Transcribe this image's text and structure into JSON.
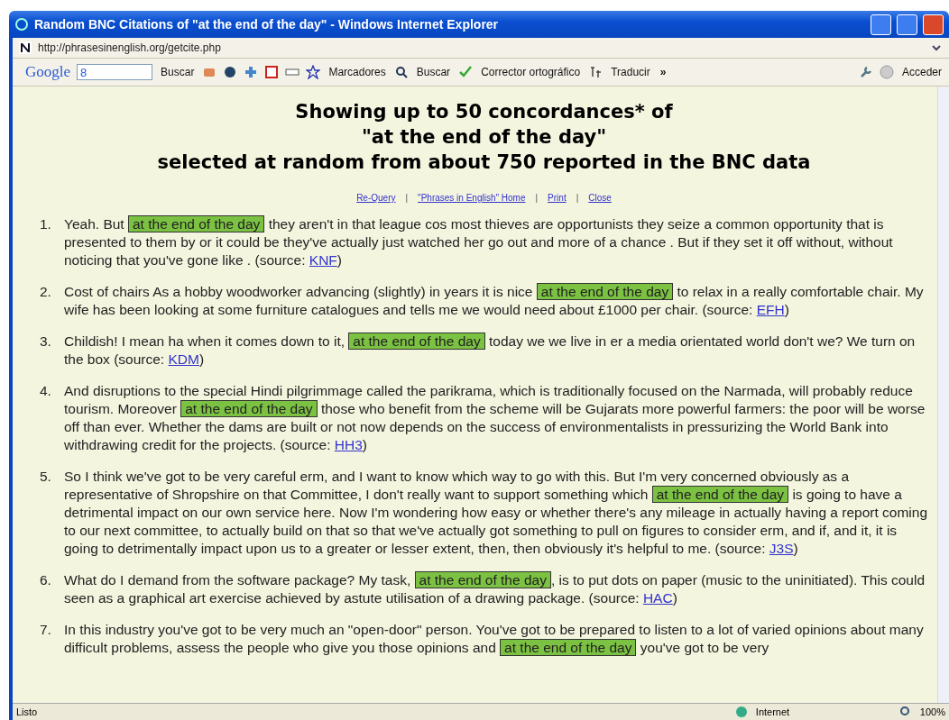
{
  "window": {
    "title": "Random BNC Citations of \"at the end of the day\" - Windows Internet Explorer"
  },
  "address_bar": {
    "url": "http://phrasesinenglish.org/getcite.php"
  },
  "toolbar": {
    "google_logo": "Google",
    "search_value": "8",
    "items": [
      {
        "kind": "text-button",
        "label": "Buscar"
      },
      {
        "kind": "text-button",
        "label": "Marcadores"
      },
      {
        "kind": "text-button",
        "label": "Buscar"
      },
      {
        "kind": "text-button",
        "label": "Corrector ortográfico"
      },
      {
        "kind": "text-button",
        "label": "Traducir"
      },
      {
        "kind": "chevron",
        "label": "»"
      },
      {
        "kind": "text-button",
        "label": "Acceder"
      }
    ]
  },
  "page": {
    "heading": [
      "Showing up to 50 concordances* of",
      "\"at the end of the day\"",
      "selected at random from about 750 reported in the BNC data"
    ],
    "nav": [
      {
        "kind": "link",
        "text": "Re-Query"
      },
      {
        "kind": "separator",
        "text": "|"
      },
      {
        "kind": "link",
        "text": "\"Phrases in English\" Home"
      },
      {
        "kind": "separator",
        "text": "|"
      },
      {
        "kind": "link",
        "text": "Print"
      },
      {
        "kind": "separator",
        "text": "|"
      },
      {
        "kind": "link",
        "text": "Close"
      }
    ],
    "citations": [
      {
        "number": "1.",
        "before": "Yeah. But",
        "phrase": "at the end of the day",
        "after": "they aren't in that league cos most thieves are opportunists they seize a common opportunity that is presented to them by or it could be they've actually just watched her go out and more of a chance . But if they set it off without, without noticing that you've gone like .",
        "source_label": "(source:",
        "source": "KNF",
        "source_end": ")"
      },
      {
        "number": "2.",
        "before": "Cost of chairs As a hobby woodworker advancing (slightly) in years it is nice",
        "phrase": "at the end of the day",
        "after": "to relax in a really comfortable chair. My wife has been looking at some furniture catalogues and tells me we would need about £1000 per chair.",
        "source_label": "(source:",
        "source": "EFH",
        "source_end": ")"
      },
      {
        "number": "3.",
        "before": "Childish! I mean ha when it comes down to it,",
        "phrase": "at the end of the day",
        "after": "today we we live in er a media orientated world don't we? We turn on the box",
        "source_label": "(source:",
        "source": "KDM",
        "source_end": ")"
      },
      {
        "number": "4.",
        "before": "And disruptions to the special Hindi pilgrimmage called the parikrama, which is traditionally focused on the Narmada, will probably reduce tourism. Moreover",
        "phrase": "at the end of the day",
        "after": "those who benefit from the scheme will be Gujarats more powerful farmers: the poor will be worse off than ever. Whether the dams are built or not now depends on the success of environmentalists in pressurizing the World Bank into withdrawing credit for the projects.",
        "source_label": "(source:",
        "source": "HH3",
        "source_end": ")"
      },
      {
        "number": "5.",
        "before": "So I think we've got to be very careful erm, and I want to know which way to go with this. But I'm very concerned obviously as a representative of Shropshire on that Committee, I don't really want to support something which",
        "phrase": "at the end of the day",
        "after": "is going to have a detrimental impact on our own service here. Now I'm wondering how easy or whether there's any mileage in actually having a report coming to our next committee, to actually build on that so that we've actually got something to pull on figures to consider erm, and if, and it, it is going to detrimentally impact upon us to a greater or lesser extent, then, then obviously it's helpful to me.",
        "source_label": "(source:",
        "source": "J3S",
        "source_end": ")"
      },
      {
        "number": "6.",
        "before": "What do I demand from the software package? My task,",
        "phrase": "at the end of the day",
        "after": ", is to put dots on paper (music to the uninitiated). This could seen as a graphical art exercise achieved by astute utilisation of a drawing package.",
        "source_label": "(source:",
        "source": "HAC",
        "source_end": ")"
      },
      {
        "number": "7.",
        "before": "In this industry you've got to be very much an \"open-door\" person. You've got to be prepared to listen to a lot of varied opinions about many difficult problems, assess the people who give you those opinions and",
        "phrase": "at the end of the day",
        "after": "you've got to be very"
      }
    ]
  },
  "status_bar": {
    "text": "Listo",
    "zone": "Internet",
    "zoom": "100%"
  }
}
